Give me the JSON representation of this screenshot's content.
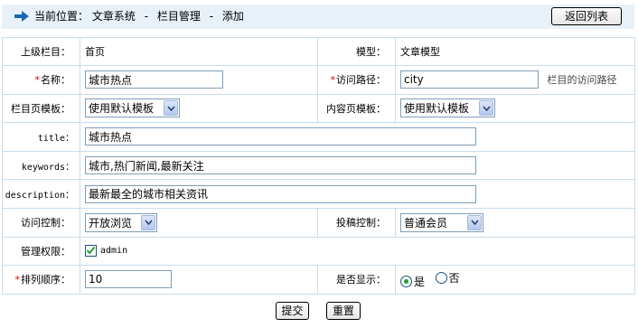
{
  "header": {
    "location_label": "当前位置：",
    "crumbs": [
      "文章系统",
      "栏目管理",
      "添加"
    ],
    "crumb_sep": "-",
    "back_button": "返回列表"
  },
  "form": {
    "parent": {
      "label": "上级栏目：",
      "value": "首页"
    },
    "model": {
      "label": "模型：",
      "value": "文章模型"
    },
    "name": {
      "label": "名称：",
      "required_mark": "*",
      "value": "城市热点"
    },
    "path": {
      "label": "访问路径：",
      "required_mark": "*",
      "value": "city",
      "hint": "栏目的访问路径"
    },
    "list_template": {
      "label": "栏目页模板：",
      "selected": "使用默认模板"
    },
    "content_template": {
      "label": "内容页模板：",
      "selected": "使用默认模板"
    },
    "title": {
      "label": "title：",
      "value": "城市热点"
    },
    "keywords": {
      "label": "keywords：",
      "value": "城市,热门新闻,最新关注"
    },
    "description": {
      "label": "description：",
      "value": "最新最全的城市相关资讯"
    },
    "access": {
      "label": "访问控制：",
      "selected": "开放浏览"
    },
    "submit_control": {
      "label": "投稿控制：",
      "selected": "普通会员"
    },
    "permission": {
      "label": "管理权限：",
      "option": "admin",
      "checked": true
    },
    "order": {
      "label": "排列顺序：",
      "required_mark": "*",
      "value": "10"
    },
    "show": {
      "label": "是否显示：",
      "options": [
        "是",
        "否"
      ],
      "selected": "是"
    }
  },
  "actions": {
    "submit": "提交",
    "reset": "重置"
  },
  "colors": {
    "accent": "#1a68b5",
    "border": "#c8dced",
    "header_bg": "#e8f1f8",
    "required": "#e00000"
  }
}
